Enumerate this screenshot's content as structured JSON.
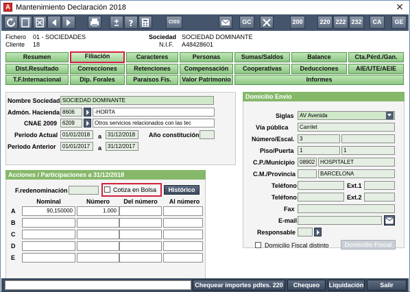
{
  "window": {
    "title": "Mantenimiento Declaración 2018",
    "close_glyph": "✕"
  },
  "toolbar": {
    "ciss_label": "CISS",
    "gc_label": "GC",
    "b200": "200",
    "b220": "220",
    "b222": "222",
    "b232": "232",
    "ca": "CA",
    "ge": "GE"
  },
  "header": {
    "fichero_label": "Fichero",
    "fichero_value": "01 - SOCIEDADES",
    "cliente_label": "Cliente",
    "cliente_value": "18",
    "sociedad_label": "Sociedad",
    "sociedad_value": "SOCIEDAD DOMINANTE",
    "nif_label": "N.I.F.",
    "nif_value": "A48428601"
  },
  "tabs": {
    "row1": [
      "Resumen",
      "Filiación",
      "Caracteres",
      "Personas",
      "Sumas/Saldos",
      "Balance",
      "Cta.Pérd./Gan."
    ],
    "row2": [
      "Dist.Resultado",
      "Correcciones",
      "Retenciones",
      "Compensación",
      "Cooperativas",
      "Deducciones",
      "AIE/UTE/AEIE"
    ],
    "row3": [
      "T.F.Internacional",
      "Dip. Forales",
      "Paraísos Fis.",
      "Valor Patrimonio",
      "Informes"
    ]
  },
  "sociedad": {
    "nombre_label": "Nombre Sociedad",
    "nombre_value": "SOCIEDAD DOMINANTE",
    "admon_label": "Admón. Hacienda",
    "admon_code": "8606",
    "admon_name": "-HORTA",
    "cnae_label": "CNAE 2009",
    "cnae_code": "6209",
    "cnae_desc": "Otros servicios relacionados con las tec",
    "periodo_actual_label": "Periodo Actual",
    "pa_from": "01/01/2018",
    "pa_to": "31/12/2018",
    "a1": "a",
    "a2": "a",
    "ano_label": "Año constitución",
    "periodo_anterior_label": "Periodo Anterior",
    "pant_from": "01/01/2017",
    "pant_to": "31/12/2017"
  },
  "acciones": {
    "header": "Acciones / Participaciones a 31/12/2018",
    "fred_label": "F.redenominación",
    "cotiza_label": "Cotiza en Bolsa",
    "historico": "Histórico",
    "cols": [
      "Nominal",
      "Número",
      "Del número",
      "Al número"
    ],
    "rows": [
      {
        "label": "A",
        "nominal": "90,150000",
        "numero": "1.000"
      },
      {
        "label": "B",
        "nominal": "",
        "numero": ""
      },
      {
        "label": "C",
        "nominal": "",
        "numero": ""
      },
      {
        "label": "D",
        "nominal": "",
        "numero": ""
      },
      {
        "label": "E",
        "nominal": "",
        "numero": ""
      }
    ]
  },
  "domicilio": {
    "header": "Domicilio Envio",
    "siglas_label": "Siglas",
    "siglas_value": "AV Avenida",
    "via_label": "Vía pública",
    "via_value": "Carrilet",
    "numero_label": "Número/Escal.",
    "numero_value": "3",
    "piso_label": "Piso/Puerta",
    "piso_value": "1",
    "puerta_value": "1",
    "cp_label": "C.P./Municipio",
    "cp_value": "08902",
    "municipio_value": "HOSPITALET",
    "cm_label": "C.M./Provincia",
    "provincia_value": "BARCELONA",
    "tel1_label": "Teléfono 1",
    "ext1_label": "Ext.1",
    "tel2_label": "Teléfono 2",
    "ext2_label": "Ext.2",
    "fax_label": "Fax",
    "email_label": "E-mail",
    "responsable_label": "Responsable",
    "fiscal_label": "Domicilio Fiscal distinto",
    "fiscal_btn": "Domicilio Fiscal"
  },
  "statusbar": {
    "chequear": "Chequear importes pdtes. 220",
    "chequeo": "Chequeo",
    "liquidacion": "Liquidación",
    "salir": "Salir"
  }
}
